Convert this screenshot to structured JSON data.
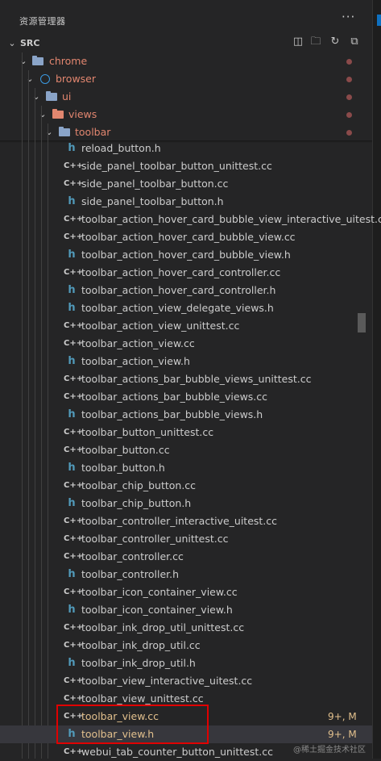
{
  "explorer": {
    "title": "资源管理器",
    "more": "···"
  },
  "root": {
    "label": "SRC"
  },
  "actions": {
    "new_file": "new-file-icon",
    "new_folder": "new-folder-icon",
    "refresh": "refresh-icon",
    "collapse": "collapse-all-icon"
  },
  "folders": [
    {
      "label": "chrome"
    },
    {
      "label": "browser"
    },
    {
      "label": "ui"
    },
    {
      "label": "views"
    },
    {
      "label": "toolbar"
    }
  ],
  "files": [
    {
      "name": "reload_button.h",
      "type": "h"
    },
    {
      "name": "side_panel_toolbar_button_unittest.cc",
      "type": "cc"
    },
    {
      "name": "side_panel_toolbar_button.cc",
      "type": "cc"
    },
    {
      "name": "side_panel_toolbar_button.h",
      "type": "h"
    },
    {
      "name": "toolbar_action_hover_card_bubble_view_interactive_uitest.cc",
      "type": "cc"
    },
    {
      "name": "toolbar_action_hover_card_bubble_view.cc",
      "type": "cc"
    },
    {
      "name": "toolbar_action_hover_card_bubble_view.h",
      "type": "h"
    },
    {
      "name": "toolbar_action_hover_card_controller.cc",
      "type": "cc"
    },
    {
      "name": "toolbar_action_hover_card_controller.h",
      "type": "h"
    },
    {
      "name": "toolbar_action_view_delegate_views.h",
      "type": "h"
    },
    {
      "name": "toolbar_action_view_unittest.cc",
      "type": "cc"
    },
    {
      "name": "toolbar_action_view.cc",
      "type": "cc"
    },
    {
      "name": "toolbar_action_view.h",
      "type": "h"
    },
    {
      "name": "toolbar_actions_bar_bubble_views_unittest.cc",
      "type": "cc"
    },
    {
      "name": "toolbar_actions_bar_bubble_views.cc",
      "type": "cc"
    },
    {
      "name": "toolbar_actions_bar_bubble_views.h",
      "type": "h"
    },
    {
      "name": "toolbar_button_unittest.cc",
      "type": "cc"
    },
    {
      "name": "toolbar_button.cc",
      "type": "cc"
    },
    {
      "name": "toolbar_button.h",
      "type": "h"
    },
    {
      "name": "toolbar_chip_button.cc",
      "type": "cc"
    },
    {
      "name": "toolbar_chip_button.h",
      "type": "h"
    },
    {
      "name": "toolbar_controller_interactive_uitest.cc",
      "type": "cc"
    },
    {
      "name": "toolbar_controller_unittest.cc",
      "type": "cc"
    },
    {
      "name": "toolbar_controller.cc",
      "type": "cc"
    },
    {
      "name": "toolbar_controller.h",
      "type": "h"
    },
    {
      "name": "toolbar_icon_container_view.cc",
      "type": "cc"
    },
    {
      "name": "toolbar_icon_container_view.h",
      "type": "h"
    },
    {
      "name": "toolbar_ink_drop_util_unittest.cc",
      "type": "cc"
    },
    {
      "name": "toolbar_ink_drop_util.cc",
      "type": "cc"
    },
    {
      "name": "toolbar_ink_drop_util.h",
      "type": "h"
    },
    {
      "name": "toolbar_view_interactive_uitest.cc",
      "type": "cc"
    },
    {
      "name": "toolbar_view_unittest.cc",
      "type": "cc"
    },
    {
      "name": "toolbar_view.cc",
      "type": "cc",
      "badge": "9+, M"
    },
    {
      "name": "toolbar_view.h",
      "type": "h",
      "badge": "9+, M",
      "selected": true
    },
    {
      "name": "webui_tab_counter_button_unittest.cc",
      "type": "cc"
    }
  ],
  "icon_glyphs": {
    "cc": "C++",
    "h": "h"
  },
  "watermark": "@稀土掘金技术社区"
}
